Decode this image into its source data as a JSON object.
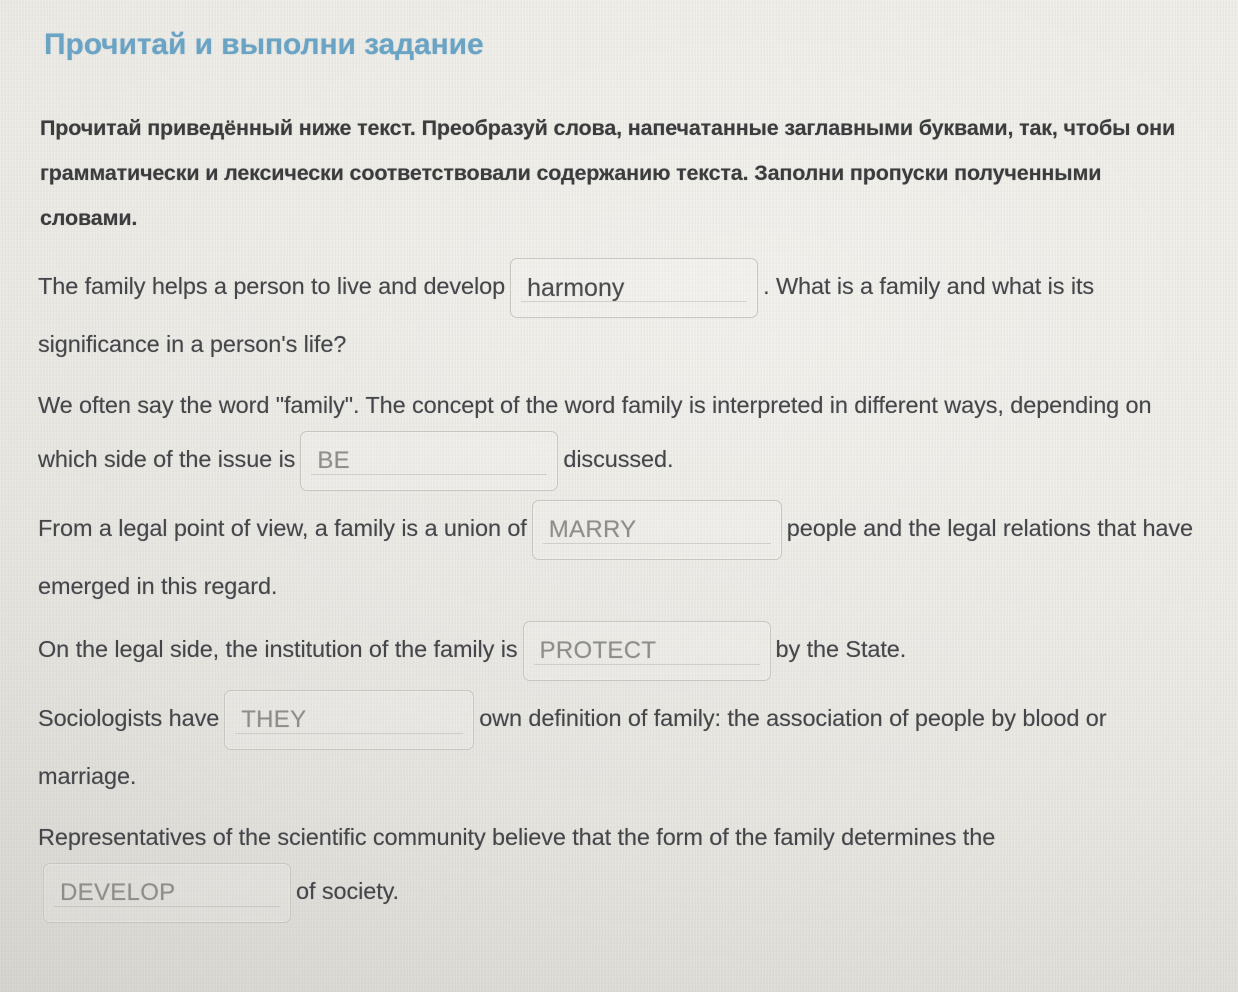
{
  "page": {
    "background_color": "#e9e7e1",
    "title_color": "#6aa3c4",
    "body_text_color": "#44464a",
    "placeholder_color": "#8d8e8c",
    "field_border_color": "#c7c6c0"
  },
  "header": {
    "title": "Прочитай и выполни задание"
  },
  "instructions": {
    "text": "Прочитай приведённый ниже текст. Преобразуй слова, напечатанные заглавными буквами, так, чтобы они грамматически и лексически соответствовали содержанию текста. Заполни пропуски полученными словами."
  },
  "exercise": {
    "paragraphs": [
      {
        "id": "p1",
        "before": "The family helps a person to live and develop",
        "field": {
          "name": "harmony",
          "value": "harmony",
          "filled": true
        },
        "after": ". What is a family and what is its significance in a person's life?"
      },
      {
        "id": "p2",
        "before": "We often say the word \"family\". The concept of the word family is interpreted in different ways, depending on which side of the issue is",
        "field": {
          "name": "be",
          "value": "BE",
          "filled": false
        },
        "after": "discussed."
      },
      {
        "id": "p3",
        "before": "From a legal point of view, a family is a union of",
        "field": {
          "name": "marry",
          "value": "MARRY",
          "filled": false
        },
        "after": "people and the legal relations that have emerged in this regard."
      },
      {
        "id": "p4",
        "before": "On the legal side, the institution of the family is",
        "field": {
          "name": "protect",
          "value": "PROTECT",
          "filled": false
        },
        "after": "by the State."
      },
      {
        "id": "p5",
        "before": "Sociologists have",
        "field": {
          "name": "they",
          "value": "THEY",
          "filled": false
        },
        "after": "own definition of family: the association of people by blood or marriage."
      },
      {
        "id": "p6",
        "before": "Representatives of the scientific community believe that the form of the family determines the",
        "field": {
          "name": "develop",
          "value": "DEVELOP",
          "filled": false
        },
        "after": "of society."
      }
    ]
  }
}
